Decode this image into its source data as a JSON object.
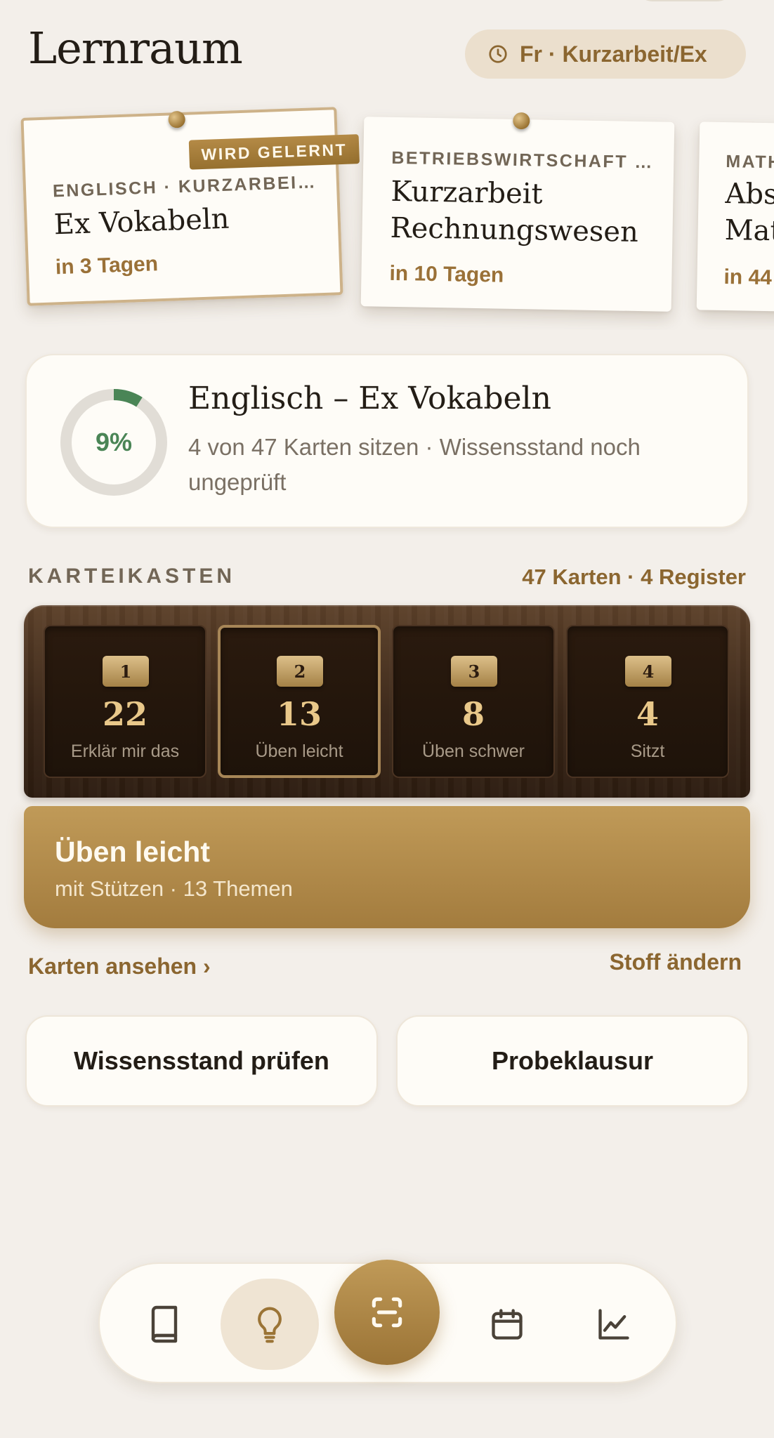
{
  "header": {
    "title": "Lernraum",
    "exam_pill": "Fr · Kurzarbeit/Ex",
    "exam_pill_icon": "clock-icon"
  },
  "notes": [
    {
      "badge": "WIRD GELERNT",
      "subject": "ENGLISCH · KURZARBEI…",
      "title_lines": [
        "Ex Vokabeln"
      ],
      "due": "in 3 Tagen",
      "active": true
    },
    {
      "subject": "BETRIEBSWIRTSCHAFT …",
      "title_lines": [
        "Kurzarbeit",
        "Rechnungswesen"
      ],
      "due": "in 10 Tagen",
      "active": false
    },
    {
      "subject": "MATH",
      "title_lines": [
        "Abs",
        "Mat"
      ],
      "due": "in 44",
      "active": false
    }
  ],
  "progress": {
    "percent_label": "9%",
    "fraction": 0.09,
    "title": "Englisch – Ex Vokabeln",
    "subtitle": "4 von 47 Karten sitzen · Wissensstand noch ungeprüft",
    "ring_color": "#4a8556",
    "track_color": "#e1ddd6"
  },
  "karteikasten": {
    "label": "KARTEIKASTEN",
    "meta": "47 Karten · 4 Register",
    "slots": [
      {
        "tab": "1",
        "count": "22",
        "label": "Erklär mir das"
      },
      {
        "tab": "2",
        "count": "13",
        "label": "Üben leicht",
        "selected": true
      },
      {
        "tab": "3",
        "count": "8",
        "label": "Üben schwer"
      },
      {
        "tab": "4",
        "count": "4",
        "label": "Sitzt"
      }
    ]
  },
  "cta": {
    "title": "Üben leicht",
    "subtitle": "mit Stützen · 13 Themen"
  },
  "links": {
    "view_cards": "Karten ansehen ›",
    "change_material": "Stoff ändern"
  },
  "actions": {
    "check_knowledge": "Wissensstand prüfen",
    "practice_exam": "Probeklausur"
  },
  "nav": {
    "items": [
      "book-icon",
      "lightbulb-icon",
      "scan-icon",
      "calendar-icon",
      "chart-icon"
    ],
    "active": "lightbulb-icon"
  },
  "colors": {
    "background": "#f3efea",
    "accent": "#a37c3e",
    "accent_text": "#8b6630",
    "wood": "#3b2718"
  }
}
